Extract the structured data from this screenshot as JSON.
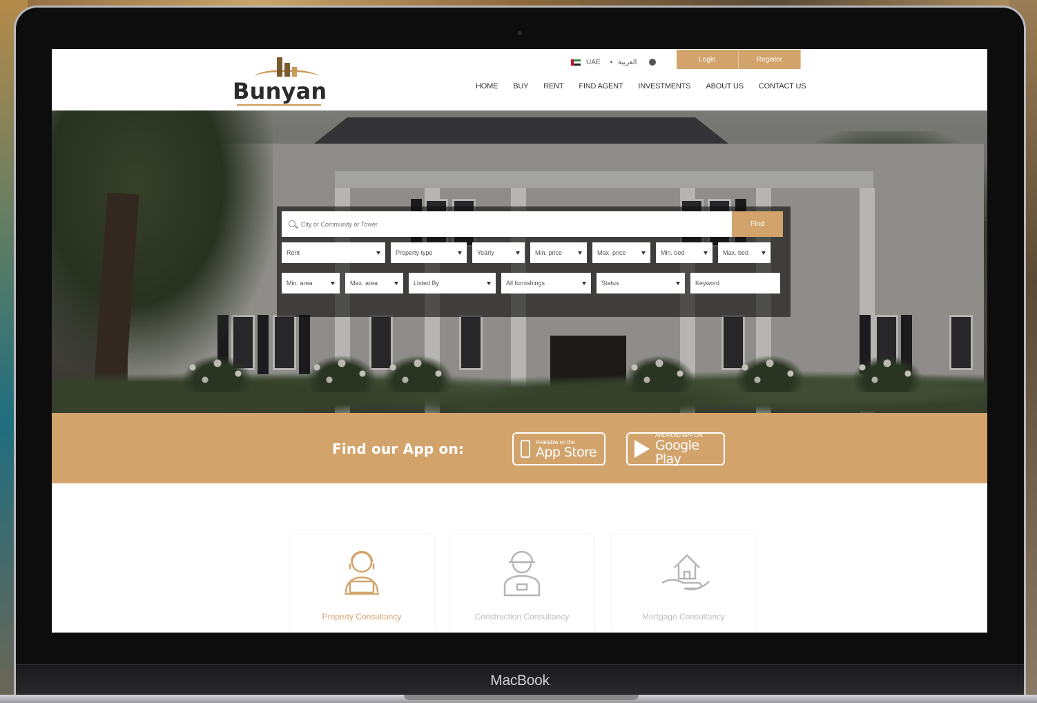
{
  "device": {
    "label": "MacBook"
  },
  "header": {
    "logo_text": "Bunyan",
    "topbar": {
      "region": "UAE",
      "language": "العربية"
    },
    "auth": {
      "login": "Login",
      "register": "Register"
    },
    "nav": [
      "HOME",
      "BUY",
      "RENT",
      "FIND AGENT",
      "INVESTMENTS",
      "ABOUT US",
      "CONTACT US"
    ]
  },
  "search": {
    "placeholder": "City or Community or Tower",
    "find_label": "Find",
    "filters_row1": [
      "Rent",
      "Property type",
      "Yearly",
      "Min. price",
      "Max. price",
      "Min. bed",
      "Max. bed"
    ],
    "filters_row2": [
      "Min. area",
      "Max. area",
      "Listed By",
      "All furnishings",
      "Status",
      "Keyword"
    ]
  },
  "app_bar": {
    "title": "Find our App on:",
    "app_store": {
      "small": "Available on the",
      "big": "App Store"
    },
    "google_play": {
      "small": "ANDROID APP ON",
      "big": "Google Play"
    }
  },
  "services": [
    {
      "label": "Property Consultancy",
      "icon": "consultant-icon",
      "color": "#d2a46c"
    },
    {
      "label": "Construction Consultancy",
      "icon": "engineer-icon",
      "color": "#bdbdbd"
    },
    {
      "label": "Mortgage Consultancy",
      "icon": "house-hand-icon",
      "color": "#bdbdbd"
    }
  ],
  "colors": {
    "accent": "#d2a46c",
    "text": "#333333"
  }
}
